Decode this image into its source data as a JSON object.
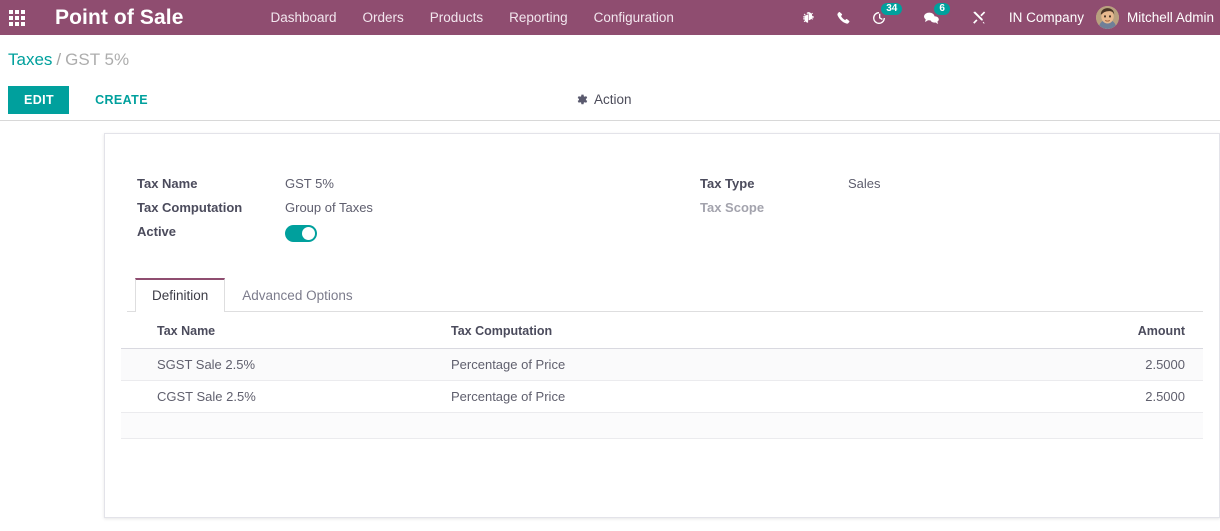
{
  "navbar": {
    "apps_icon": "apps-grid-icon",
    "brand": "Point of Sale",
    "menu": [
      {
        "label": "Dashboard"
      },
      {
        "label": "Orders"
      },
      {
        "label": "Products"
      },
      {
        "label": "Reporting"
      },
      {
        "label": "Configuration"
      }
    ],
    "systray": [
      {
        "icon": "bug-icon",
        "badge": null
      },
      {
        "icon": "phone-icon",
        "badge": null
      },
      {
        "icon": "activity-clock-icon",
        "badge": "34"
      },
      {
        "icon": "messages-chat-icon",
        "badge": "6"
      },
      {
        "icon": "tools-icon",
        "badge": null
      }
    ],
    "company": "IN Company",
    "user": "Mitchell Admin",
    "brand_color": "#8f4d70",
    "badge_color": "#00a09d"
  },
  "control_panel": {
    "breadcrumb": {
      "root": "Taxes",
      "separator": "/",
      "current": "GST 5%"
    },
    "edit_label": "EDIT",
    "create_label": "CREATE",
    "action_label": "Action",
    "action_icon": "gear-icon",
    "accent_color": "#00a09d"
  },
  "form": {
    "left_fields": [
      {
        "label": "Tax Name",
        "value": "GST 5%",
        "muted": false
      },
      {
        "label": "Tax Computation",
        "value": "Group of Taxes",
        "muted": false
      }
    ],
    "active_field": {
      "label": "Active",
      "state": "on"
    },
    "right_fields": [
      {
        "label": "Tax Type",
        "value": "Sales",
        "muted": false
      },
      {
        "label": "Tax Scope",
        "value": "",
        "muted": true
      }
    ]
  },
  "notebook": {
    "tabs": [
      {
        "label": "Definition",
        "active": true
      },
      {
        "label": "Advanced Options",
        "active": false
      }
    ],
    "table": {
      "columns": [
        "Tax Name",
        "Tax Computation",
        "Amount"
      ],
      "rows": [
        {
          "tax_name": "SGST Sale 2.5%",
          "tax_computation": "Percentage of Price",
          "amount": "2.5000"
        },
        {
          "tax_name": "CGST Sale 2.5%",
          "tax_computation": "Percentage of Price",
          "amount": "2.5000"
        }
      ]
    }
  }
}
